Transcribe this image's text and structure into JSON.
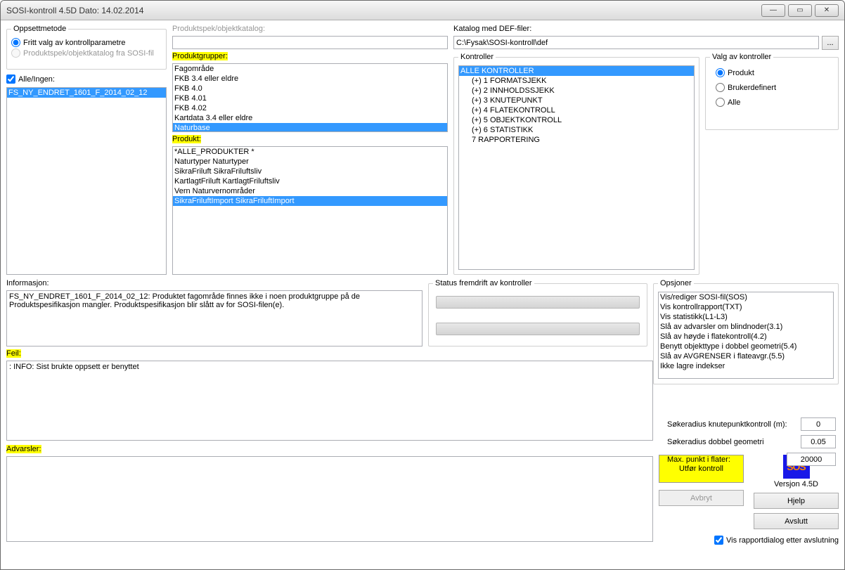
{
  "titlebar": {
    "title": "SOSI-kontroll 4.5D   Dato: 14.02.2014"
  },
  "oppsettmetode": {
    "legend": "Oppsettmetode",
    "fritt": "Fritt valg av kontrollparametre",
    "produktspek": "Produktspek/objektkatalog fra SOSI-fil"
  },
  "alleIngen": {
    "label": "Alle/Ingen:",
    "items": [
      "FS_NY_ENDRET_1601_F_2014_02_12"
    ]
  },
  "produktspek": {
    "label": "Produktspek/objektkatalog:",
    "value": ""
  },
  "produktgrupper": {
    "label": "Produktgrupper:",
    "items": [
      "Fagområde",
      "FKB 3.4 eller eldre",
      "FKB 4.0",
      "FKB 4.01",
      "FKB 4.02",
      "Kartdata 3.4 eller eldre",
      "Naturbase"
    ],
    "selected": "Naturbase"
  },
  "produkt": {
    "label": "Produkt:",
    "items": [
      "*ALLE_PRODUKTER  *",
      "Naturtyper  Naturtyper",
      "SikraFriluft  SikraFriluftsliv",
      "KartlagtFriluft  KartlagtFriluftsliv",
      "Vern  Naturvernområder",
      "SikraFriluftImport  SikraFriluftImport"
    ],
    "selected": "SikraFriluftImport  SikraFriluftImport"
  },
  "katalogDef": {
    "label": "Katalog med DEF-filer:",
    "value": "C:\\Fysak\\SOSI-kontroll\\def",
    "browse": "..."
  },
  "kontroller": {
    "legend": "Kontroller",
    "items": [
      "ALLE KONTROLLER",
      "(+) 1 FORMATSJEKK",
      "(+) 2 INNHOLDSSJEKK",
      "(+) 3 KNUTEPUNKT",
      "(+) 4 FLATEKONTROLL",
      "(+) 5 OBJEKTKONTROLL",
      "(+) 6 STATISTIKK",
      "7 RAPPORTERING"
    ],
    "selected": "ALLE KONTROLLER"
  },
  "valgKontroller": {
    "legend": "Valg av kontroller",
    "produkt": "Produkt",
    "bruker": "Brukerdefinert",
    "alle": "Alle"
  },
  "informasjon": {
    "label": "Informasjon:",
    "text": "FS_NY_ENDRET_1601_F_2014_02_12: Produktet fagområde finnes ikke i noen produktgruppe på de\nProduktspesifikasjon mangler. Produktspesifikasjon blir slått av for SOSI-filen(e)."
  },
  "statusFremdrift": {
    "legend": "Status fremdrift av kontroller"
  },
  "feil": {
    "label": "Feil:",
    "text": ": INFO: Sist brukte oppsett er benyttet"
  },
  "advarsler": {
    "label": "Advarsler:",
    "text": ""
  },
  "opsjoner": {
    "legend": "Opsjoner",
    "items": [
      "Vis/rediger SOSI-fil(SOS)",
      "Vis kontrollrapport(TXT)",
      "Vis statistikk(L1-L3)",
      "Slå av advarsler om blindnoder(3.1)",
      "Slå av høyde i flatekontroll(4.2)",
      "Benytt objekttype i dobbel geometri(5.4)",
      "Slå av AVGRENSER i flateavgr.(5.5)",
      "Ikke lagre indekser"
    ]
  },
  "params": {
    "sokeradiusKnute": {
      "label": "Søkeradius knutepunktkontroll (m):",
      "value": "0"
    },
    "sokeradiusDobbel": {
      "label": "Søkeradius dobbel geometri",
      "value": "0.05"
    },
    "maxPunkt": {
      "label": "Max. punkt i flater:",
      "value": "20000"
    }
  },
  "buttons": {
    "utfor": "Utfør kontroll",
    "avbryt": "Avbryt",
    "hjelp": "Hjelp",
    "avslutt": "Avslutt",
    "versjon": "Versjon 4.5D",
    "visRapport": "Vis rapportdialog etter avslutning"
  }
}
